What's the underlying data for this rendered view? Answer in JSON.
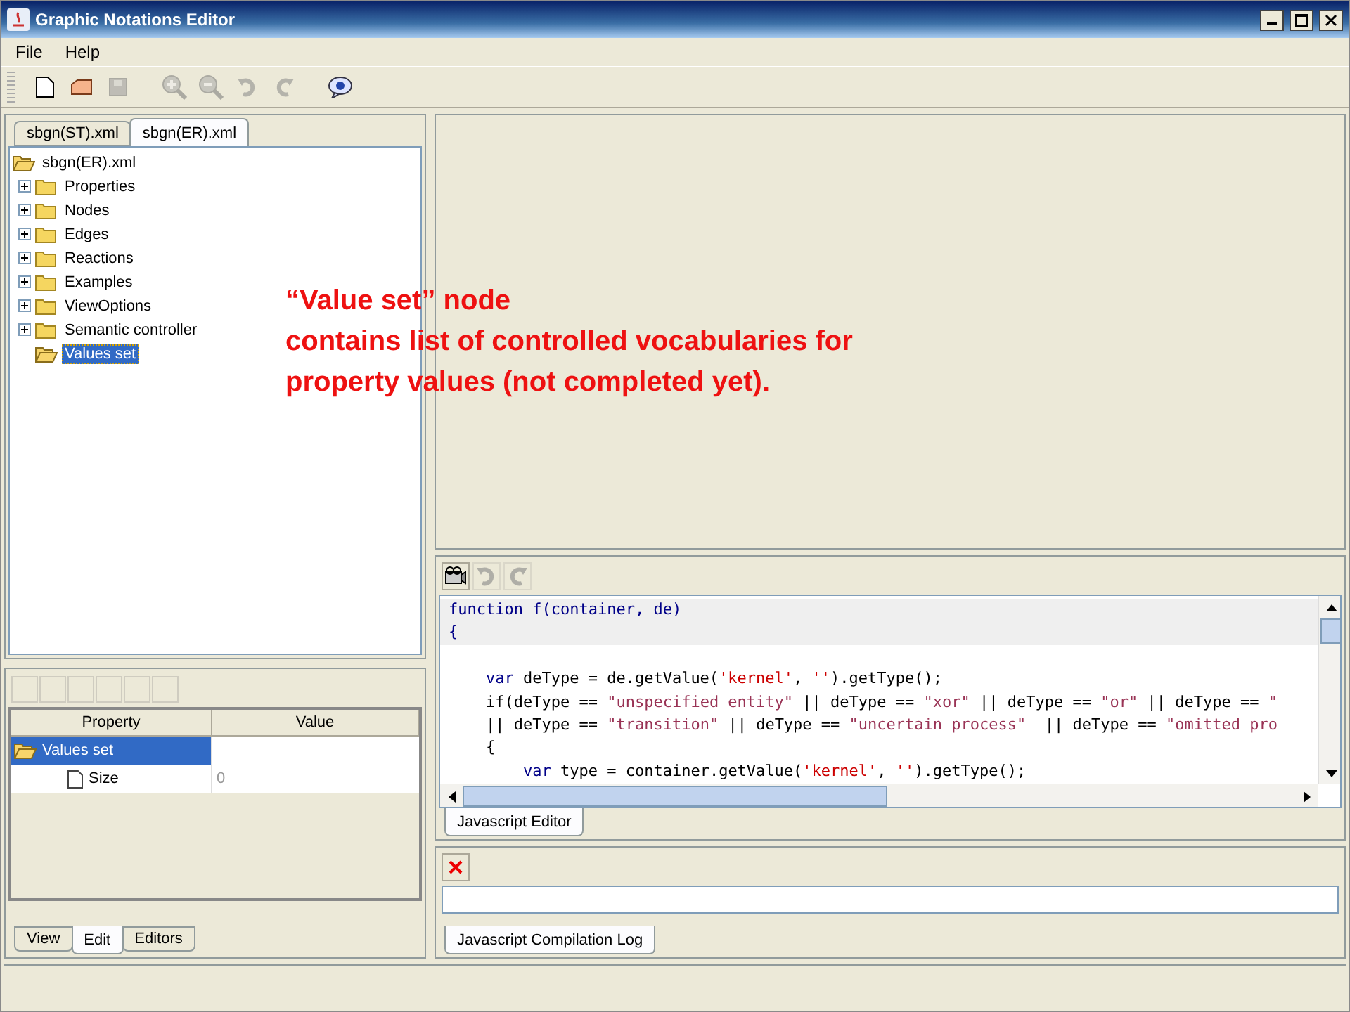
{
  "window": {
    "title": "Graphic Notations Editor"
  },
  "menu": [
    {
      "label": "File"
    },
    {
      "label": "Help"
    }
  ],
  "toolbar": [
    {
      "kind": "new",
      "disabled": false
    },
    {
      "kind": "open",
      "disabled": false
    },
    {
      "kind": "save",
      "disabled": true
    },
    {
      "kind": "zoom-in",
      "disabled": true
    },
    {
      "kind": "zoom-out",
      "disabled": true
    },
    {
      "kind": "undo",
      "disabled": true
    },
    {
      "kind": "redo",
      "disabled": true
    },
    {
      "kind": "info",
      "disabled": false
    }
  ],
  "file_tabs": [
    {
      "label": "sbgn(ST).xml",
      "selected": false
    },
    {
      "label": "sbgn(ER).xml",
      "selected": true
    }
  ],
  "tree": {
    "label": "sbgn(ER).xml",
    "children": [
      {
        "label": "Properties",
        "collapsed": true,
        "selected": false
      },
      {
        "label": "Nodes",
        "collapsed": true,
        "selected": false
      },
      {
        "label": "Edges",
        "collapsed": true,
        "selected": false
      },
      {
        "label": "Reactions",
        "collapsed": true,
        "selected": false
      },
      {
        "label": "Examples",
        "collapsed": true,
        "selected": false
      },
      {
        "label": "ViewOptions",
        "collapsed": true,
        "selected": false
      },
      {
        "label": "Semantic controller",
        "collapsed": true,
        "selected": false
      },
      {
        "label": "Values set",
        "collapsed": false,
        "selected": true
      }
    ]
  },
  "annotation": {
    "lines": [
      "“Value set” node",
      "contains list of controlled vocabularies for",
      "property values (not completed yet)."
    ]
  },
  "property_table": {
    "columns": [
      "Property",
      "Value"
    ],
    "rows": [
      {
        "property": "Values set",
        "kind": "folder",
        "selected": true,
        "children": [
          {
            "property": "Size",
            "value": "0",
            "kind": "leaf",
            "selected": false
          }
        ]
      }
    ]
  },
  "bottom_tabs": [
    {
      "label": "View",
      "selected": false
    },
    {
      "label": "Edit",
      "selected": true
    },
    {
      "label": "Editors",
      "selected": false
    }
  ],
  "editor_toolbar": [
    {
      "kind": "run",
      "disabled": false
    },
    {
      "kind": "undo",
      "disabled": true
    },
    {
      "kind": "redo",
      "disabled": true
    }
  ],
  "code": [
    {
      "highlighted": true,
      "tokens": [
        {
          "kind": "keyword",
          "text": "function f(container, de)"
        }
      ]
    },
    {
      "highlighted": true,
      "tokens": [
        {
          "kind": "keyword",
          "text": "{"
        }
      ]
    },
    {
      "highlighted": false
    },
    {
      "highlighted": false,
      "tokens": [
        {
          "kind": "keyword",
          "text": "    var"
        },
        {
          "kind": "plain",
          "text": " deType = de.getValue("
        },
        {
          "kind": "string",
          "text": "'kernel'"
        },
        {
          "kind": "plain",
          "text": ", "
        },
        {
          "kind": "string",
          "text": "''"
        },
        {
          "kind": "plain",
          "text": ").getType();"
        }
      ]
    },
    {
      "highlighted": false,
      "tokens": [
        {
          "kind": "plain",
          "text": "    if(deType == "
        },
        {
          "kind": "literal",
          "text": "\"unspecified entity\""
        },
        {
          "kind": "plain",
          "text": " || deType == "
        },
        {
          "kind": "literal",
          "text": "\"xor\""
        },
        {
          "kind": "plain",
          "text": " || deType == "
        },
        {
          "kind": "literal",
          "text": "\"or\""
        },
        {
          "kind": "plain",
          "text": " || deType == "
        },
        {
          "kind": "literal",
          "text": "\""
        }
      ]
    },
    {
      "highlighted": false,
      "tokens": [
        {
          "kind": "plain",
          "text": "    || deType == "
        },
        {
          "kind": "literal",
          "text": "\"transition\""
        },
        {
          "kind": "plain",
          "text": " || deType == "
        },
        {
          "kind": "literal",
          "text": "\"uncertain process\""
        },
        {
          "kind": "plain",
          "text": "  || deType == "
        },
        {
          "kind": "literal",
          "text": "\"omitted pro"
        }
      ]
    },
    {
      "highlighted": false,
      "tokens": [
        {
          "kind": "plain",
          "text": "    {"
        }
      ]
    },
    {
      "highlighted": false,
      "tokens": [
        {
          "kind": "keyword",
          "text": "        var"
        },
        {
          "kind": "plain",
          "text": " type = container.getValue("
        },
        {
          "kind": "string",
          "text": "'kernel'"
        },
        {
          "kind": "plain",
          "text": ", "
        },
        {
          "kind": "string",
          "text": "''"
        },
        {
          "kind": "plain",
          "text": ").getType();"
        }
      ]
    }
  ],
  "editor_tab": {
    "label": "Javascript Editor",
    "selected": true
  },
  "log_toolbar": [
    {
      "kind": "clear",
      "disabled": false
    }
  ],
  "log_tab": {
    "label": "Javascript Compilation Log",
    "selected": true
  }
}
